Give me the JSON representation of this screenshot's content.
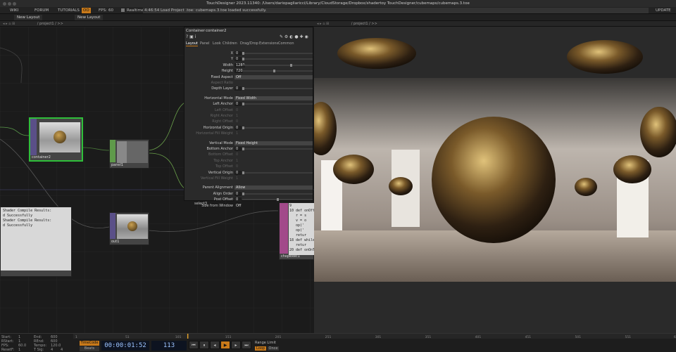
{
  "window": {
    "title": "TouchDesigner 2023.11340: /Users/dariopagliaricci/Library/CloudStorage/Dropbox/shadertoy TouchDesigner/cubemaps/cubemaps.3.toe"
  },
  "menubar": {
    "wiki": "WIKI",
    "forum": "FORUM",
    "tutorials": "TUTORIALS",
    "oo": "OO",
    "fps_label": "FPS:",
    "fps_value": "60",
    "realtime": "Realtime",
    "status": "4:46:54 Load Project .toe: cubemaps.3.toe loaded successfully.",
    "update": "UPDATE"
  },
  "tabs": {
    "new_layout_1": "New Layout",
    "new_layout_2": "New Layout"
  },
  "paths": {
    "network": "/ project1 / >>",
    "viewer": "/ project1 / >>"
  },
  "nodes": {
    "container2": "container2",
    "panel1": "panel1",
    "out1": "out1",
    "select3": "select3",
    "chopexec1": "chopexec1",
    "shader_log": [
      "Shader Compile Results:",
      "",
      "d Successfully",
      "",
      "Shader Compile Results:",
      "",
      "d Successfully"
    ],
    "code_lines": [
      "9",
      "10 def onOff",
      "   r = s",
      "   v = o",
      "   op('",
      "   op('",
      "   retur",
      "",
      "18 def while",
      "   retur",
      "",
      "20 def onOnT"
    ]
  },
  "params": {
    "op_type": "Container",
    "op_name": "container2",
    "tabs": [
      "Layout",
      "Panel",
      "Look",
      "Children",
      "Drag/Drop",
      "Extensions",
      "Common"
    ],
    "rows": [
      {
        "label": "X",
        "value": "0",
        "kind": "slider",
        "knob": 0.0
      },
      {
        "label": "Y",
        "value": "0",
        "kind": "slider",
        "knob": 0.0
      },
      {
        "label": "Width",
        "value": "1280",
        "kind": "slider",
        "knob": 0.7
      },
      {
        "label": "Height",
        "value": "720",
        "kind": "slider",
        "knob": 0.45
      },
      {
        "label": "Fixed Aspect",
        "value": "Off",
        "kind": "menu"
      },
      {
        "label": "Aspect Ratio",
        "value": "",
        "kind": "dim"
      },
      {
        "label": "Depth Layer",
        "value": "0",
        "kind": "slider",
        "knob": 0.0
      },
      {
        "label": "",
        "value": "",
        "kind": "gap"
      },
      {
        "label": "Horizontal Mode",
        "value": "Fixed Width",
        "kind": "menu"
      },
      {
        "label": "Left Anchor",
        "value": "0",
        "kind": "slider",
        "knob": 0.0
      },
      {
        "label": "Left Offset",
        "value": "0",
        "kind": "dim"
      },
      {
        "label": "Right Anchor",
        "value": "1",
        "kind": "dim"
      },
      {
        "label": "Right Offset",
        "value": "0",
        "kind": "dim"
      },
      {
        "label": "Horizontal Origin",
        "value": "0",
        "kind": "slider",
        "knob": 0.0
      },
      {
        "label": "Horizontal Fill Weight",
        "value": "1",
        "kind": "dim"
      },
      {
        "label": "",
        "value": "",
        "kind": "gap"
      },
      {
        "label": "Vertical Mode",
        "value": "Fixed Height",
        "kind": "menu"
      },
      {
        "label": "Bottom Anchor",
        "value": "0",
        "kind": "slider",
        "knob": 0.0
      },
      {
        "label": "Bottom Offset",
        "value": "0",
        "kind": "dim"
      },
      {
        "label": "Top Anchor",
        "value": "1",
        "kind": "dim"
      },
      {
        "label": "Top Offset",
        "value": "0",
        "kind": "dim"
      },
      {
        "label": "Vertical Origin",
        "value": "0",
        "kind": "slider",
        "knob": 0.0
      },
      {
        "label": "Vertical Fill Weight",
        "value": "1",
        "kind": "dim"
      },
      {
        "label": "",
        "value": "",
        "kind": "gap"
      },
      {
        "label": "Parent Alignment",
        "value": "Allow",
        "kind": "menu"
      },
      {
        "label": "Align Order",
        "value": "0",
        "kind": "slider",
        "knob": 0.0
      },
      {
        "label": "Post Offset",
        "value": "0",
        "kind": "slider",
        "knob": 0.5
      },
      {
        "label": "Size from Window",
        "value": "Off",
        "kind": "toggle"
      }
    ]
  },
  "timeline": {
    "start_label": "Start:",
    "start": "1",
    "end_label": "End:",
    "end": "600",
    "rstart_label": "RStart:",
    "rstart": "1",
    "rend_label": "REnd:",
    "rend": "600",
    "fps_label": "FPS:",
    "fps": "60.0",
    "tempo_label": "Tempo:",
    "tempo": "120.0",
    "reset_label": "ResetF:",
    "reset": "1",
    "tsig_label": "T Sig:",
    "tsig_a": "4",
    "tsig_b": "4",
    "timecode_btn": "TimeCode",
    "beats_btn": "Beats",
    "timecode": "00:00:01:52",
    "frame": "113",
    "range_limit": "Range Limit",
    "loop": "Loop",
    "once": "Once",
    "ruler": [
      "1",
      "51",
      "101",
      "151",
      "201",
      "251",
      "301",
      "351",
      "401",
      "451",
      "501",
      "551",
      "600"
    ],
    "playhead_frame": 113,
    "accent": "#e0a02a"
  }
}
